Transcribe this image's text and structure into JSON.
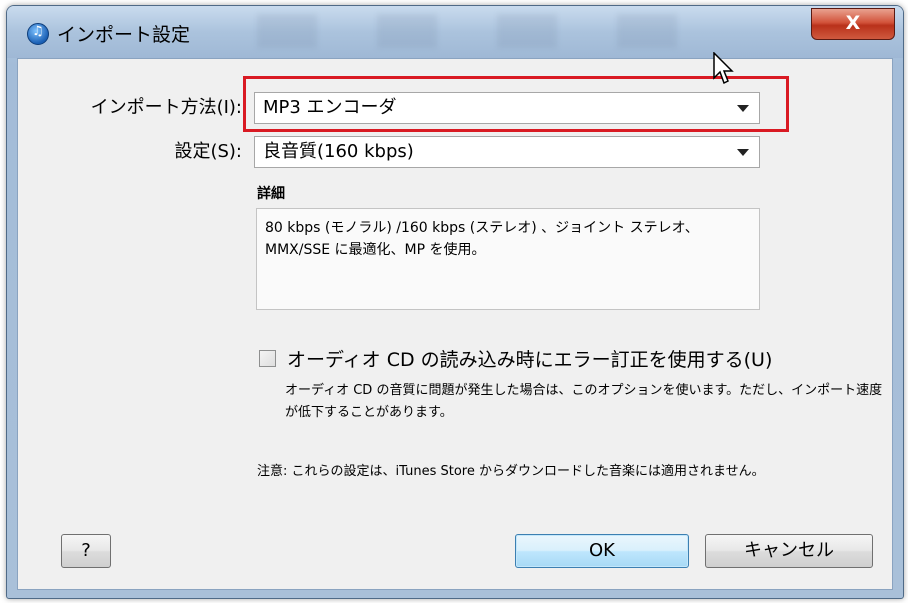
{
  "window": {
    "title": "インポート設定",
    "close_label": "X"
  },
  "form": {
    "import_method_label": "インポート方法(I):",
    "import_method_value": "MP3 エンコーダ",
    "setting_label": "設定(S):",
    "setting_value": "良音質(160 kbps)",
    "details_heading": "詳細",
    "details_text": "80 kbps (モノラル) /160 kbps (ステレオ) 、ジョイント ステレオ、MMX/SSE に最適化、MP を使用。"
  },
  "error_correction": {
    "checked": false,
    "label": "オーディオ CD の読み込み時にエラー訂正を使用する(U)",
    "help": "オーディオ CD の音質に問題が発生した場合は、このオプションを使います。ただし、インポート速度が低下することがあります。"
  },
  "note": "注意: これらの設定は、iTunes Store からダウンロードした音楽には適用されません。",
  "buttons": {
    "help": "?",
    "ok": "OK",
    "cancel": "キャンセル"
  },
  "colors": {
    "highlight": "#d91a23",
    "close_button": "#c9452c"
  },
  "icons": [
    "itunes-app-icon",
    "close-icon",
    "dropdown-arrow-icon",
    "mouse-cursor-icon"
  ]
}
